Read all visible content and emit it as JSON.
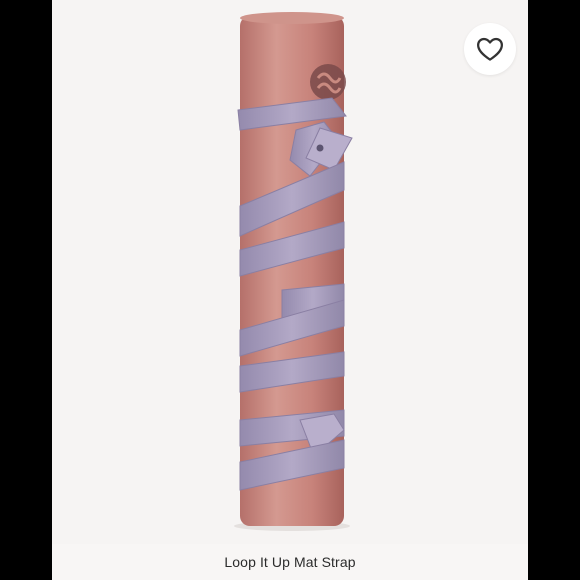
{
  "product": {
    "title": "Loop It Up Mat Strap",
    "image_subject": "yoga mat rolled with strap"
  },
  "actions": {
    "like_icon": "heart-outline-icon"
  },
  "colors": {
    "mat": "#c9857c",
    "strap": "#a79bbd",
    "logo": "#7a4a4a",
    "background": "#f6f4f3"
  }
}
